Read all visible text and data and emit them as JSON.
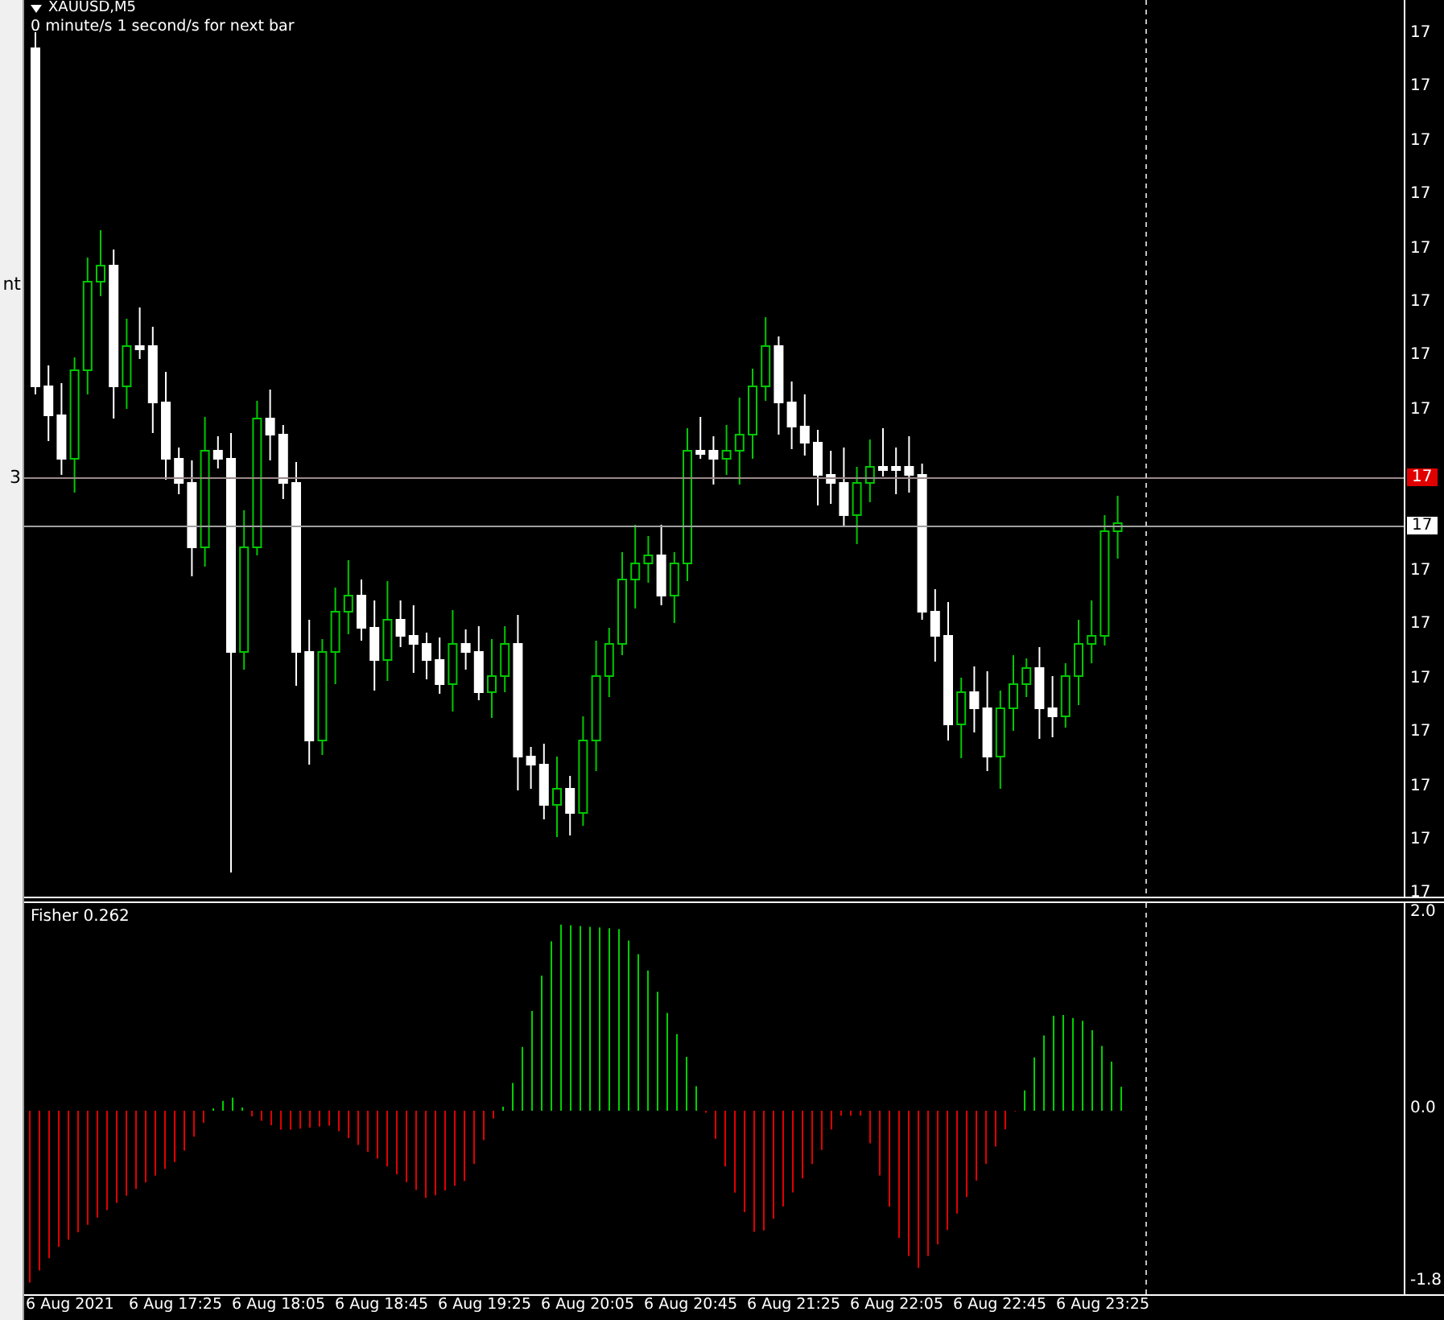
{
  "sidebar": {
    "texts": [
      "nt",
      "3"
    ]
  },
  "chart": {
    "symbol": "XAUUSD,M5",
    "timer": "0 minute/s 1 second/s for next bar",
    "price_axis": {
      "labels": [
        "17",
        "17",
        "17",
        "17",
        "17",
        "17",
        "17",
        "17",
        "17",
        "17",
        "17",
        "17",
        "17",
        "17",
        "17"
      ],
      "bid_tag": "17",
      "ask_tag": "17"
    }
  },
  "indicator": {
    "title": "Fisher 0.262",
    "axis_labels": [
      "2.0",
      "0.0",
      "-1.8"
    ]
  },
  "time_axis": {
    "labels": [
      "6 Aug 2021",
      "6 Aug 17:25",
      "6 Aug 18:05",
      "6 Aug 18:45",
      "6 Aug 19:25",
      "6 Aug 20:05",
      "6 Aug 20:45",
      "6 Aug 21:25",
      "6 Aug 22:05",
      "6 Aug 22:45",
      "6 Aug 23:25"
    ]
  }
}
